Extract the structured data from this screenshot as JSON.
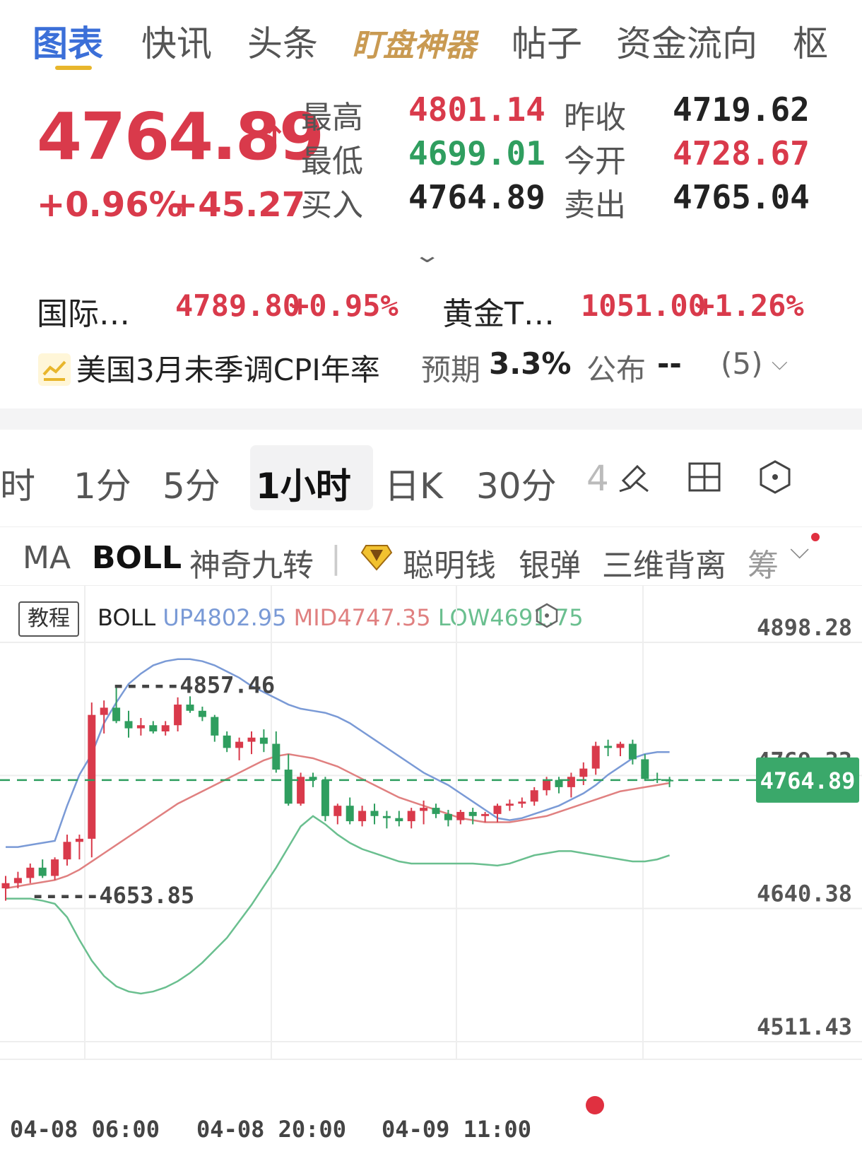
{
  "tabs": [
    {
      "label": "图表",
      "active": true
    },
    {
      "label": "快讯"
    },
    {
      "label": "头条"
    },
    {
      "label": "盯盘神器"
    },
    {
      "label": "帖子"
    },
    {
      "label": "资金流向"
    },
    {
      "label": "枢"
    }
  ],
  "quote": {
    "price": "4764.89",
    "change_pct": "+0.96%",
    "change_abs": "+45.27",
    "high_label": "最高",
    "high": "4801.14",
    "low_label": "最低",
    "low": "4699.01",
    "bid_label": "买入",
    "bid": "4764.89",
    "prev_close_label": "昨收",
    "prev_close": "4719.62",
    "open_label": "今开",
    "open": "4728.67",
    "ask_label": "卖出",
    "ask": "4765.04"
  },
  "related": [
    {
      "name": "国际…",
      "price": "4789.80",
      "pct": "+0.95%"
    },
    {
      "name": "黄金T…",
      "price": "1051.00",
      "pct": "+1.26%"
    }
  ],
  "event": {
    "title": "美国3月未季调CPI年率",
    "expect_label": "预期",
    "expect_value": "3.3%",
    "publish_label": "公布",
    "publish_value": "--",
    "count": "(5)"
  },
  "periods": [
    "时",
    "1分",
    "5分",
    "1小时",
    "日K",
    "30分",
    "4"
  ],
  "indicators": [
    "MA",
    "BOLL",
    "神奇九转",
    "聪明钱",
    "银弹",
    "三维背离",
    "筹"
  ],
  "chart_data": {
    "type": "candlestick",
    "tutorial_label": "教程",
    "legend": {
      "name": "BOLL",
      "up": "UP4802.95",
      "mid": "MID4747.35",
      "low": "LOW4691.75"
    },
    "y_axis_labels": [
      "4898.28",
      "4769.33",
      "4640.38",
      "4511.43"
    ],
    "x_axis_labels": [
      "04-08 06:00",
      "04-08 20:00",
      "04-09 11:00"
    ],
    "current_price": "4764.89",
    "high_mark": "4857.46",
    "low_mark": "4653.85",
    "ylim": [
      4511.43,
      4898.28
    ],
    "colors": {
      "up": "#d93a4b",
      "down": "#2f9e5f",
      "boll_up": "#7a9ad6",
      "boll_mid": "#e08080",
      "boll_low": "#6abf8f"
    },
    "candles": [
      [
        4660,
        4672,
        4648,
        4665
      ],
      [
        4665,
        4676,
        4660,
        4670
      ],
      [
        4670,
        4684,
        4665,
        4680
      ],
      [
        4680,
        4688,
        4670,
        4672
      ],
      [
        4672,
        4690,
        4668,
        4688
      ],
      [
        4688,
        4712,
        4682,
        4705
      ],
      [
        4705,
        4712,
        4688,
        4708
      ],
      [
        4708,
        4840,
        4690,
        4828
      ],
      [
        4828,
        4842,
        4810,
        4835
      ],
      [
        4835,
        4857,
        4820,
        4822
      ],
      [
        4822,
        4832,
        4806,
        4815
      ],
      [
        4815,
        4825,
        4808,
        4818
      ],
      [
        4818,
        4822,
        4810,
        4812
      ],
      [
        4812,
        4822,
        4808,
        4818
      ],
      [
        4818,
        4845,
        4812,
        4838
      ],
      [
        4838,
        4846,
        4830,
        4832
      ],
      [
        4832,
        4836,
        4822,
        4826
      ],
      [
        4826,
        4828,
        4802,
        4808
      ],
      [
        4808,
        4812,
        4792,
        4796
      ],
      [
        4796,
        4806,
        4784,
        4802
      ],
      [
        4802,
        4812,
        4790,
        4806
      ],
      [
        4806,
        4814,
        4792,
        4800
      ],
      [
        4800,
        4812,
        4772,
        4775
      ],
      [
        4775,
        4790,
        4740,
        4742
      ],
      [
        4742,
        4772,
        4740,
        4768
      ],
      [
        4768,
        4772,
        4758,
        4765
      ],
      [
        4765,
        4768,
        4725,
        4730
      ],
      [
        4730,
        4742,
        4722,
        4740
      ],
      [
        4740,
        4748,
        4722,
        4725
      ],
      [
        4725,
        4740,
        4720,
        4735
      ],
      [
        4735,
        4742,
        4722,
        4730
      ],
      [
        4730,
        4735,
        4718,
        4728
      ],
      [
        4728,
        4735,
        4720,
        4725
      ],
      [
        4725,
        4738,
        4718,
        4735
      ],
      [
        4735,
        4745,
        4722,
        4738
      ],
      [
        4738,
        4742,
        4728,
        4732
      ],
      [
        4732,
        4736,
        4720,
        4726
      ],
      [
        4726,
        4736,
        4722,
        4734
      ],
      [
        4734,
        4738,
        4722,
        4730
      ],
      [
        4730,
        4734,
        4724,
        4732
      ],
      [
        4732,
        4742,
        4724,
        4740
      ],
      [
        4740,
        4746,
        4735,
        4742
      ],
      [
        4742,
        4748,
        4738,
        4744
      ],
      [
        4744,
        4758,
        4740,
        4755
      ],
      [
        4755,
        4768,
        4750,
        4765
      ],
      [
        4765,
        4768,
        4752,
        4758
      ],
      [
        4758,
        4772,
        4748,
        4768
      ],
      [
        4768,
        4782,
        4760,
        4776
      ],
      [
        4776,
        4802,
        4770,
        4798
      ],
      [
        4798,
        4804,
        4788,
        4796
      ],
      [
        4796,
        4802,
        4788,
        4800
      ],
      [
        4800,
        4804,
        4780,
        4785
      ],
      [
        4785,
        4790,
        4764,
        4766
      ],
      [
        4766,
        4772,
        4762,
        4765
      ],
      [
        4765,
        4768,
        4758,
        4764
      ]
    ],
    "boll_up": [
      4700,
      4700,
      4702,
      4704,
      4706,
      4740,
      4770,
      4790,
      4820,
      4840,
      4858,
      4868,
      4876,
      4880,
      4882,
      4882,
      4880,
      4876,
      4870,
      4864,
      4856,
      4850,
      4844,
      4838,
      4834,
      4832,
      4830,
      4826,
      4820,
      4812,
      4804,
      4796,
      4788,
      4780,
      4772,
      4766,
      4760,
      4752,
      4744,
      4736,
      4728,
      4726,
      4728,
      4732,
      4736,
      4740,
      4746,
      4752,
      4760,
      4770,
      4778,
      4786,
      4790,
      4792,
      4792
    ],
    "boll_mid": [
      4660,
      4662,
      4664,
      4666,
      4668,
      4672,
      4678,
      4686,
      4694,
      4702,
      4710,
      4718,
      4726,
      4734,
      4742,
      4748,
      4754,
      4760,
      4766,
      4772,
      4778,
      4784,
      4788,
      4790,
      4788,
      4786,
      4782,
      4778,
      4772,
      4766,
      4760,
      4754,
      4748,
      4744,
      4740,
      4736,
      4732,
      4728,
      4726,
      4724,
      4724,
      4724,
      4726,
      4728,
      4730,
      4734,
      4738,
      4742,
      4746,
      4750,
      4754,
      4756,
      4758,
      4760,
      4762
    ],
    "boll_low": [
      4650,
      4650,
      4650,
      4648,
      4645,
      4632,
      4610,
      4590,
      4575,
      4565,
      4560,
      4558,
      4560,
      4564,
      4570,
      4578,
      4588,
      4600,
      4612,
      4628,
      4644,
      4662,
      4680,
      4700,
      4720,
      4730,
      4722,
      4712,
      4704,
      4698,
      4694,
      4690,
      4686,
      4684,
      4684,
      4684,
      4684,
      4684,
      4684,
      4683,
      4682,
      4684,
      4688,
      4692,
      4694,
      4696,
      4696,
      4694,
      4692,
      4690,
      4688,
      4686,
      4686,
      4688,
      4692
    ]
  }
}
